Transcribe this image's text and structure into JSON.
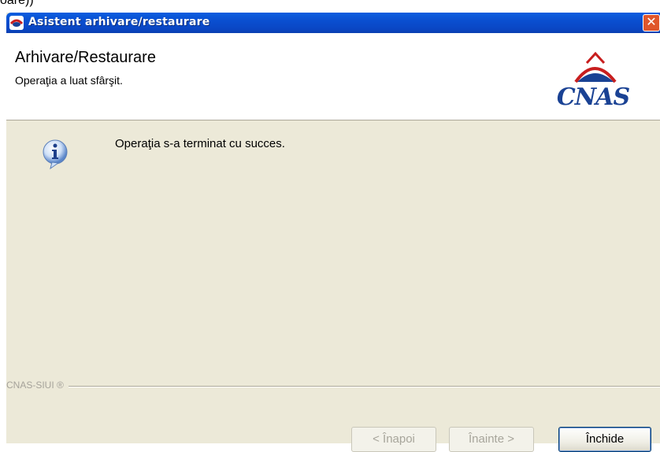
{
  "fragment_text": "oare))",
  "window": {
    "title": "Asistent arhivare/restaurare",
    "close_glyph": "✕"
  },
  "header": {
    "title": "Arhivare/Restaurare",
    "subtitle": "Operaţia a luat sfârşit.",
    "logo_text": "CNAS"
  },
  "body": {
    "message": "Operaţia s-a terminat cu succes.",
    "icon": "info-icon"
  },
  "footer": {
    "brand": "CNAS-SIUI ®",
    "buttons": {
      "back": "< Înapoi",
      "next": "Înainte >",
      "close": "Închide"
    }
  },
  "colors": {
    "titlebar": "#0a4fd0",
    "dialog_bg": "#ece9d8",
    "close_button": "#e0562b",
    "logo": "#1a4294"
  }
}
